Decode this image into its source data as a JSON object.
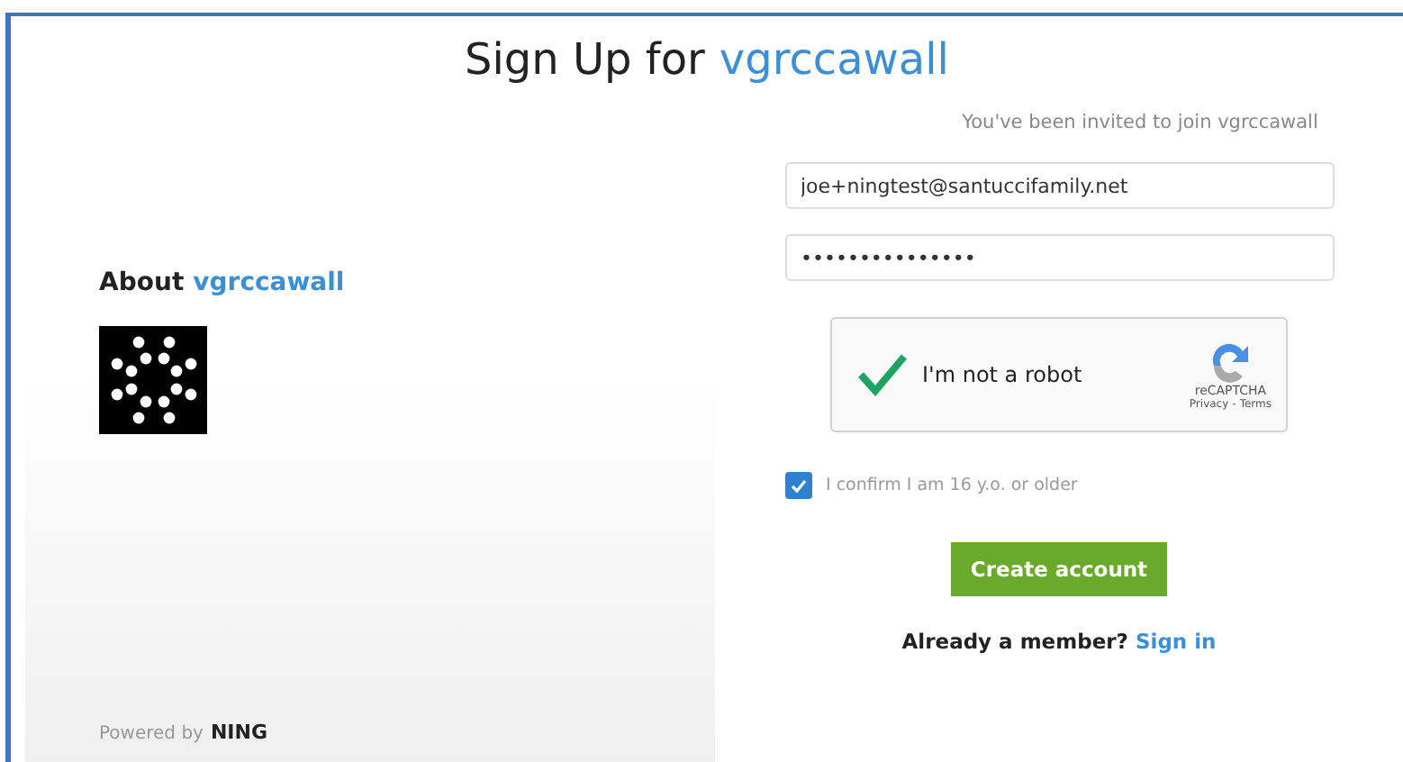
{
  "title": {
    "text": "Sign Up for",
    "site": "vgrccawall"
  },
  "about": {
    "text": "About",
    "site": "vgrccawall"
  },
  "powered_by": {
    "text": "Powered by",
    "brand": "NING"
  },
  "invite": "You've been invited to join vgrccawall",
  "email": {
    "value": "joe+ningtest@santuccifamily.net"
  },
  "password": {
    "value": "•••••••••••••••"
  },
  "captcha": {
    "label": "I'm not a robot",
    "checked": true,
    "brand": "reCAPTCHA",
    "privacy": "Privacy",
    "separator": "-",
    "terms": "Terms"
  },
  "age_confirm": {
    "label": "I confirm I am 16 y.o. or older",
    "checked": true
  },
  "submit": "Create account",
  "member": {
    "text": "Already a member?",
    "link": "Sign in"
  }
}
